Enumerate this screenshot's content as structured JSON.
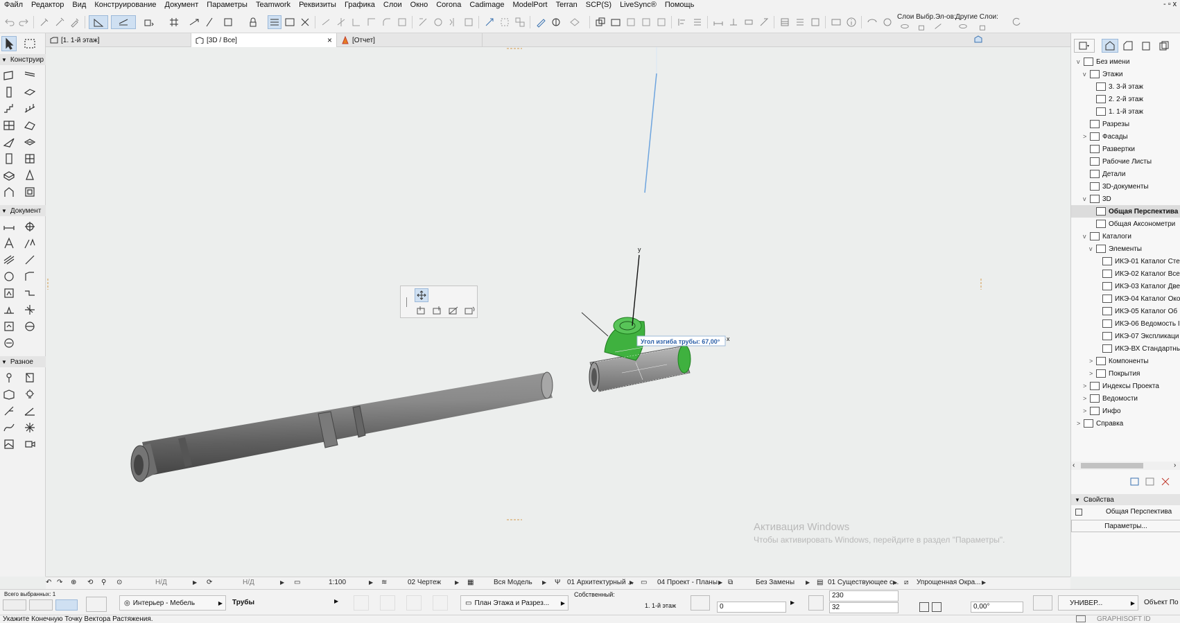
{
  "menubar": {
    "items": [
      "Файл",
      "Редактор",
      "Вид",
      "Конструирование",
      "Документ",
      "Параметры",
      "Teamwork",
      "Реквизиты",
      "Графика",
      "Слои",
      "Окно",
      "Corona",
      "Cadimage",
      "ModelPort",
      "Terran",
      "SCP(S)",
      "LiveSync®",
      "Помощь"
    ],
    "window_controls": "- ▫ x"
  },
  "toolbar": {
    "layers_label": "Слои Выбр.Эл-ов:",
    "other_layers_label": "Другие Слои:"
  },
  "tabs": [
    {
      "label": "[1. 1-й этаж]",
      "icon": "floorplan-icon"
    },
    {
      "label": "[3D / Все]",
      "icon": "3d-icon",
      "close": "×"
    },
    {
      "label": "[Отчет]",
      "icon": "report-icon"
    }
  ],
  "toolbox": {
    "sections": [
      "Конструир",
      "Документ",
      "Разное"
    ]
  },
  "viewport": {
    "axis_y": "y",
    "axis_x": "x",
    "tooltip": "Угол изгиба трубы: 67,00°"
  },
  "navigator": {
    "items": [
      {
        "label": "Без имени",
        "level": 0,
        "twisty": "v",
        "icon": "project-icon"
      },
      {
        "label": "Этажи",
        "level": 1,
        "twisty": "v",
        "icon": "stories-icon"
      },
      {
        "label": "3. 3-й этаж",
        "level": 2,
        "twisty": "",
        "icon": "story-icon"
      },
      {
        "label": "2. 2-й этаж",
        "level": 2,
        "twisty": "",
        "icon": "story-icon"
      },
      {
        "label": "1. 1-й этаж",
        "level": 2,
        "twisty": "",
        "icon": "story-icon"
      },
      {
        "label": "Разрезы",
        "level": 1,
        "twisty": "",
        "icon": "sections-icon"
      },
      {
        "label": "Фасады",
        "level": 1,
        "twisty": ">",
        "icon": "elevations-icon"
      },
      {
        "label": "Развертки",
        "level": 1,
        "twisty": "",
        "icon": "interior-elevations-icon"
      },
      {
        "label": "Рабочие Листы",
        "level": 1,
        "twisty": "",
        "icon": "worksheets-icon"
      },
      {
        "label": "Детали",
        "level": 1,
        "twisty": "",
        "icon": "details-icon"
      },
      {
        "label": "3D-документы",
        "level": 1,
        "twisty": "",
        "icon": "3d-documents-icon"
      },
      {
        "label": "3D",
        "level": 1,
        "twisty": "v",
        "icon": "3d-icon"
      },
      {
        "label": "Общая Перспектива",
        "level": 2,
        "twisty": "",
        "icon": "perspective-icon",
        "selected": true
      },
      {
        "label": "Общая Аксонометри",
        "level": 2,
        "twisty": "",
        "icon": "axonometry-icon"
      },
      {
        "label": "Каталоги",
        "level": 1,
        "twisty": "v",
        "icon": "schedules-icon"
      },
      {
        "label": "Элементы",
        "level": 2,
        "twisty": "v",
        "icon": "elements-icon"
      },
      {
        "label": "ИКЭ-01 Каталог Сте",
        "level": 3,
        "twisty": "",
        "icon": "table-icon"
      },
      {
        "label": "ИКЭ-02 Каталог Все",
        "level": 3,
        "twisty": "",
        "icon": "table-icon"
      },
      {
        "label": "ИКЭ-03 Каталог Две",
        "level": 3,
        "twisty": "",
        "icon": "table-icon"
      },
      {
        "label": "ИКЭ-04 Каталог Око",
        "level": 3,
        "twisty": "",
        "icon": "table-icon"
      },
      {
        "label": "ИКЭ-05 Каталог Об",
        "level": 3,
        "twisty": "",
        "icon": "table-icon"
      },
      {
        "label": "ИКЭ-06 Ведомость I",
        "level": 3,
        "twisty": "",
        "icon": "table-icon"
      },
      {
        "label": "ИКЭ-07 Экспликаци",
        "level": 3,
        "twisty": "",
        "icon": "table-icon"
      },
      {
        "label": "ИКЭ-ВХ Стандартны",
        "level": 3,
        "twisty": "",
        "icon": "table-icon"
      },
      {
        "label": "Компоненты",
        "level": 2,
        "twisty": ">",
        "icon": "components-icon"
      },
      {
        "label": "Покрытия",
        "level": 2,
        "twisty": ">",
        "icon": "surfaces-icon"
      },
      {
        "label": "Индексы Проекта",
        "level": 1,
        "twisty": ">",
        "icon": "project-indexes-icon"
      },
      {
        "label": "Ведомости",
        "level": 1,
        "twisty": ">",
        "icon": "lists-icon"
      },
      {
        "label": "Инфо",
        "level": 1,
        "twisty": ">",
        "icon": "info-icon"
      },
      {
        "label": "Справка",
        "level": 0,
        "twisty": ">",
        "icon": "help-icon"
      }
    ],
    "properties_label": "Свойства",
    "properties_value": "Общая Перспектива",
    "params_button": "Параметры..."
  },
  "infobar": {
    "nd1": "Н/Д",
    "nd2": "Н/Д",
    "scale": "1:100",
    "drawing": "02 Чертеж",
    "model": "Вся Модель",
    "layer_combo": "01 Архитектурный ...",
    "pen_set": "04 Проект - Планы",
    "override": "Без Замены",
    "renovation": "01 Существующее с...",
    "view_mode": "Упрощенная Окра..."
  },
  "bottombar": {
    "selected_count": "Всего выбранных: 1",
    "favorite": "Интерьер - Мебель",
    "element_type": "Трубы",
    "view_filter": "План Этажа и Разрез...",
    "own_label": "Собственный:",
    "story": "1. 1-й этаж",
    "offset_value": "0",
    "width_value": "230",
    "height_value": "32",
    "angle_value": "0,00°",
    "universal_button": "УНИВЕР...",
    "object_label": "Объект По"
  },
  "watermark": {
    "line1": "Активация Windows",
    "line2": "Чтобы активировать Windows, перейдите в раздел \"Параметры\"."
  },
  "statusbar": {
    "message": "Укажите Конечную Точку Вектора Растяжения.",
    "brand": "GRAPHISOFT ID"
  }
}
